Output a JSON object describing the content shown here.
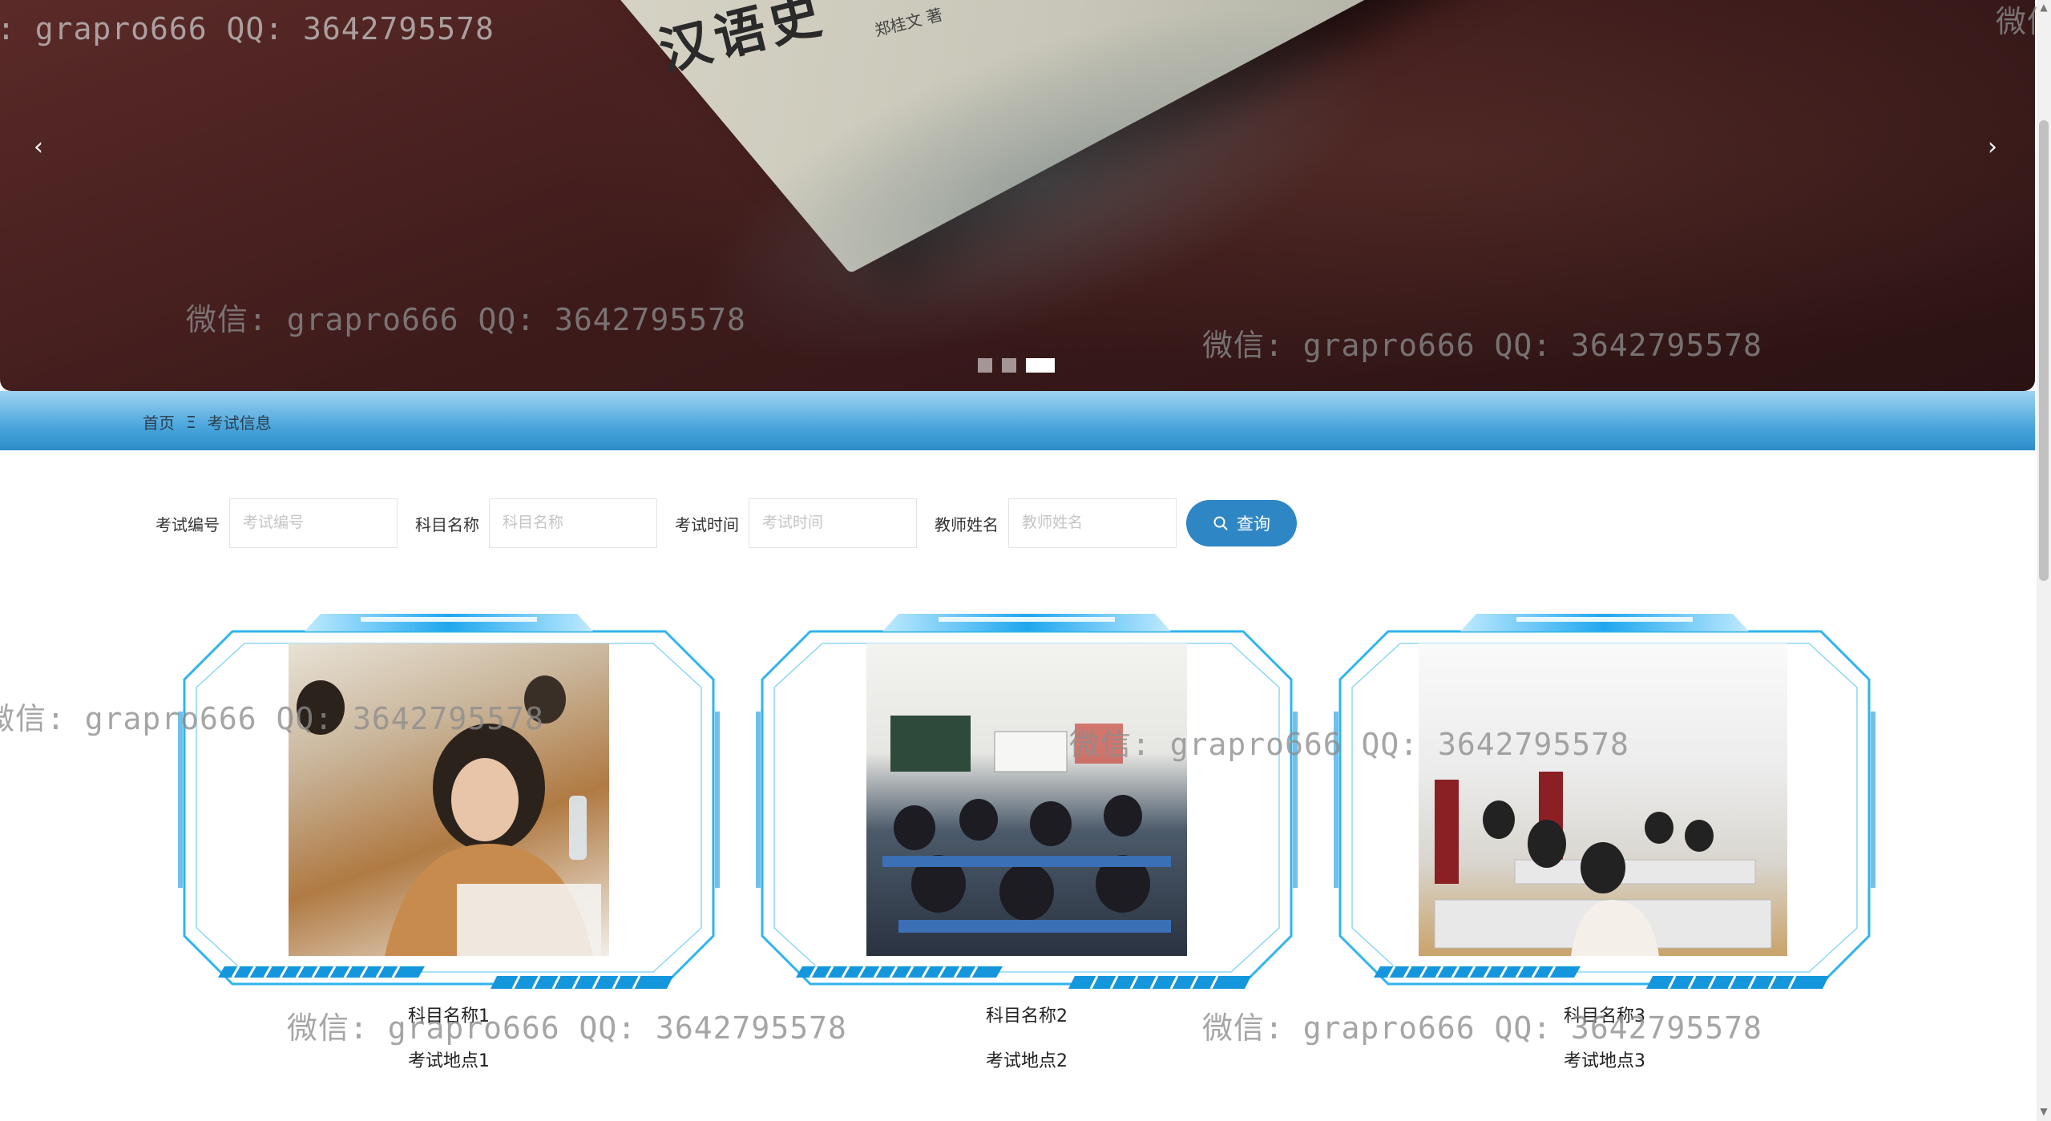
{
  "banner": {
    "book_title": "汉语史",
    "book_author": "郑桂文 著",
    "prev_icon": "‹",
    "next_icon": "›",
    "slide_count": 3,
    "active_slide": 3
  },
  "watermark": "微信: grapro666 QQ: 3642795578",
  "watermark_partial_top_left": ": grapro666 QQ: 3642795578",
  "watermark_partial_top_right": "微信",
  "breadcrumb": {
    "home": "首页",
    "separator": "Ξ",
    "current": "考试信息"
  },
  "search": {
    "fields": [
      {
        "label": "考试编号",
        "placeholder": "考试编号"
      },
      {
        "label": "科目名称",
        "placeholder": "科目名称"
      },
      {
        "label": "考试时间",
        "placeholder": "考试时间"
      },
      {
        "label": "教师姓名",
        "placeholder": "教师姓名"
      }
    ],
    "button_label": "查询",
    "button_icon": "search-icon"
  },
  "cards": [
    {
      "name": "科目名称1",
      "place": "考试地点1"
    },
    {
      "name": "科目名称2",
      "place": "考试地点2"
    },
    {
      "name": "科目名称3",
      "place": "考试地点3"
    }
  ],
  "colors": {
    "primary": "#2f86c4",
    "breadcrumb_bar": "#4aa6dc",
    "frame_cyan": "#2fb4ee"
  }
}
